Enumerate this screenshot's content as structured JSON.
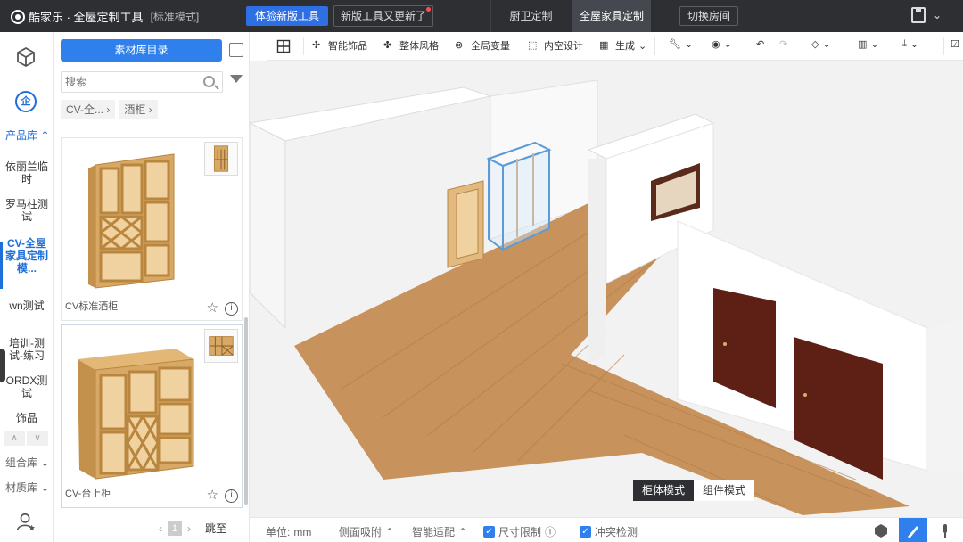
{
  "topbar": {
    "brand": "酷家乐 · 全屋定制工具",
    "mode_tag": "[标准模式]",
    "try_button": "体验新版工具",
    "new_button": "新版工具又更新了",
    "nav_bath": "厨卫定制",
    "nav_cabinet": "全屋家具定制",
    "switch_room": "切换房间"
  },
  "sidebar": {
    "product_lib": "产品库 ⌃",
    "items": [
      "依丽兰临时",
      "罗马柱测试",
      "CV-全屋家具定制模...",
      "wn测试",
      "培训-测试-练习",
      "ORDX测试",
      "饰品"
    ],
    "combo_lib": "组合库",
    "material_lib": "材质库"
  },
  "panel": {
    "catalog_button": "素材库目录",
    "search_placeholder": "搜索",
    "breadcrumb": [
      "CV-全...",
      "酒柜"
    ],
    "cards": [
      {
        "name": "CV标准酒柜"
      },
      {
        "name": "CV-台上柜"
      }
    ],
    "page": "1",
    "jump": "跳至"
  },
  "toolbar": {
    "items": [
      "智能饰品",
      "整体风格",
      "全局变量",
      "内空设计",
      "生成"
    ]
  },
  "viewport": {
    "mode_on": "柜体模式",
    "mode_off": "组件模式"
  },
  "statusbar": {
    "unit_label": "单位:",
    "unit_value": "mm",
    "side_view": "侧面吸附",
    "smart_fit": "智能适配",
    "size_limit": "尺寸限制",
    "collision": "冲突检测"
  },
  "colors": {
    "accent": "#2f80ed",
    "topbar": "#2d2f33",
    "floor": "#c08a55",
    "door": "#5e1f14"
  }
}
